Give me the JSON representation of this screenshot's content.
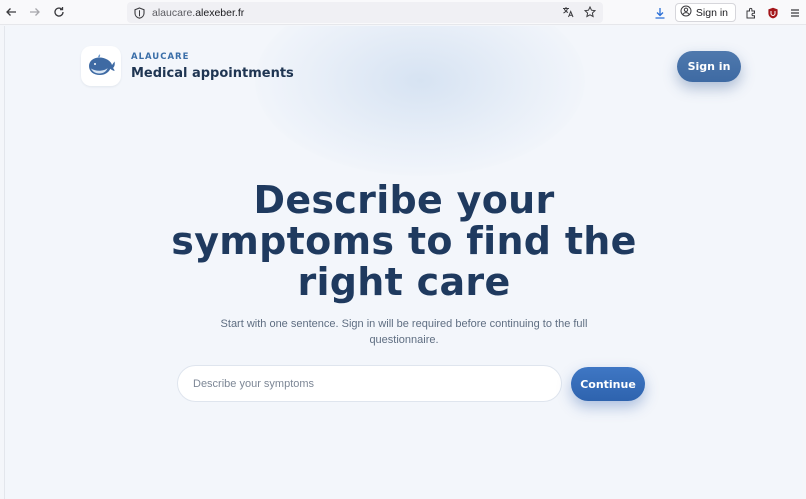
{
  "browser": {
    "url_host": "alaucare.",
    "url_domain": "alexeber.fr",
    "signin_label": "Sign in",
    "icons": [
      "back-icon",
      "forward-icon",
      "reload-icon",
      "shield-icon",
      "translate-icon",
      "star-icon",
      "download-icon",
      "account-icon",
      "extensions-icon",
      "ublock-icon",
      "menu-icon"
    ]
  },
  "header": {
    "brand_small": "ALAUCARE",
    "brand_title": "Medical appointments",
    "signin_label": "Sign in"
  },
  "hero": {
    "title_lines": [
      "Describe your",
      "symptoms to find the",
      "right care"
    ],
    "subtitle": "Start with one sentence. Sign in will be required before continuing to the full questionnaire."
  },
  "search": {
    "placeholder": "Describe your symptoms",
    "value": "",
    "continue_label": "Continue"
  },
  "colors": {
    "accent": "#3e6aa3",
    "title": "#1f3a5f",
    "page_bg": "#f3f6fb"
  }
}
